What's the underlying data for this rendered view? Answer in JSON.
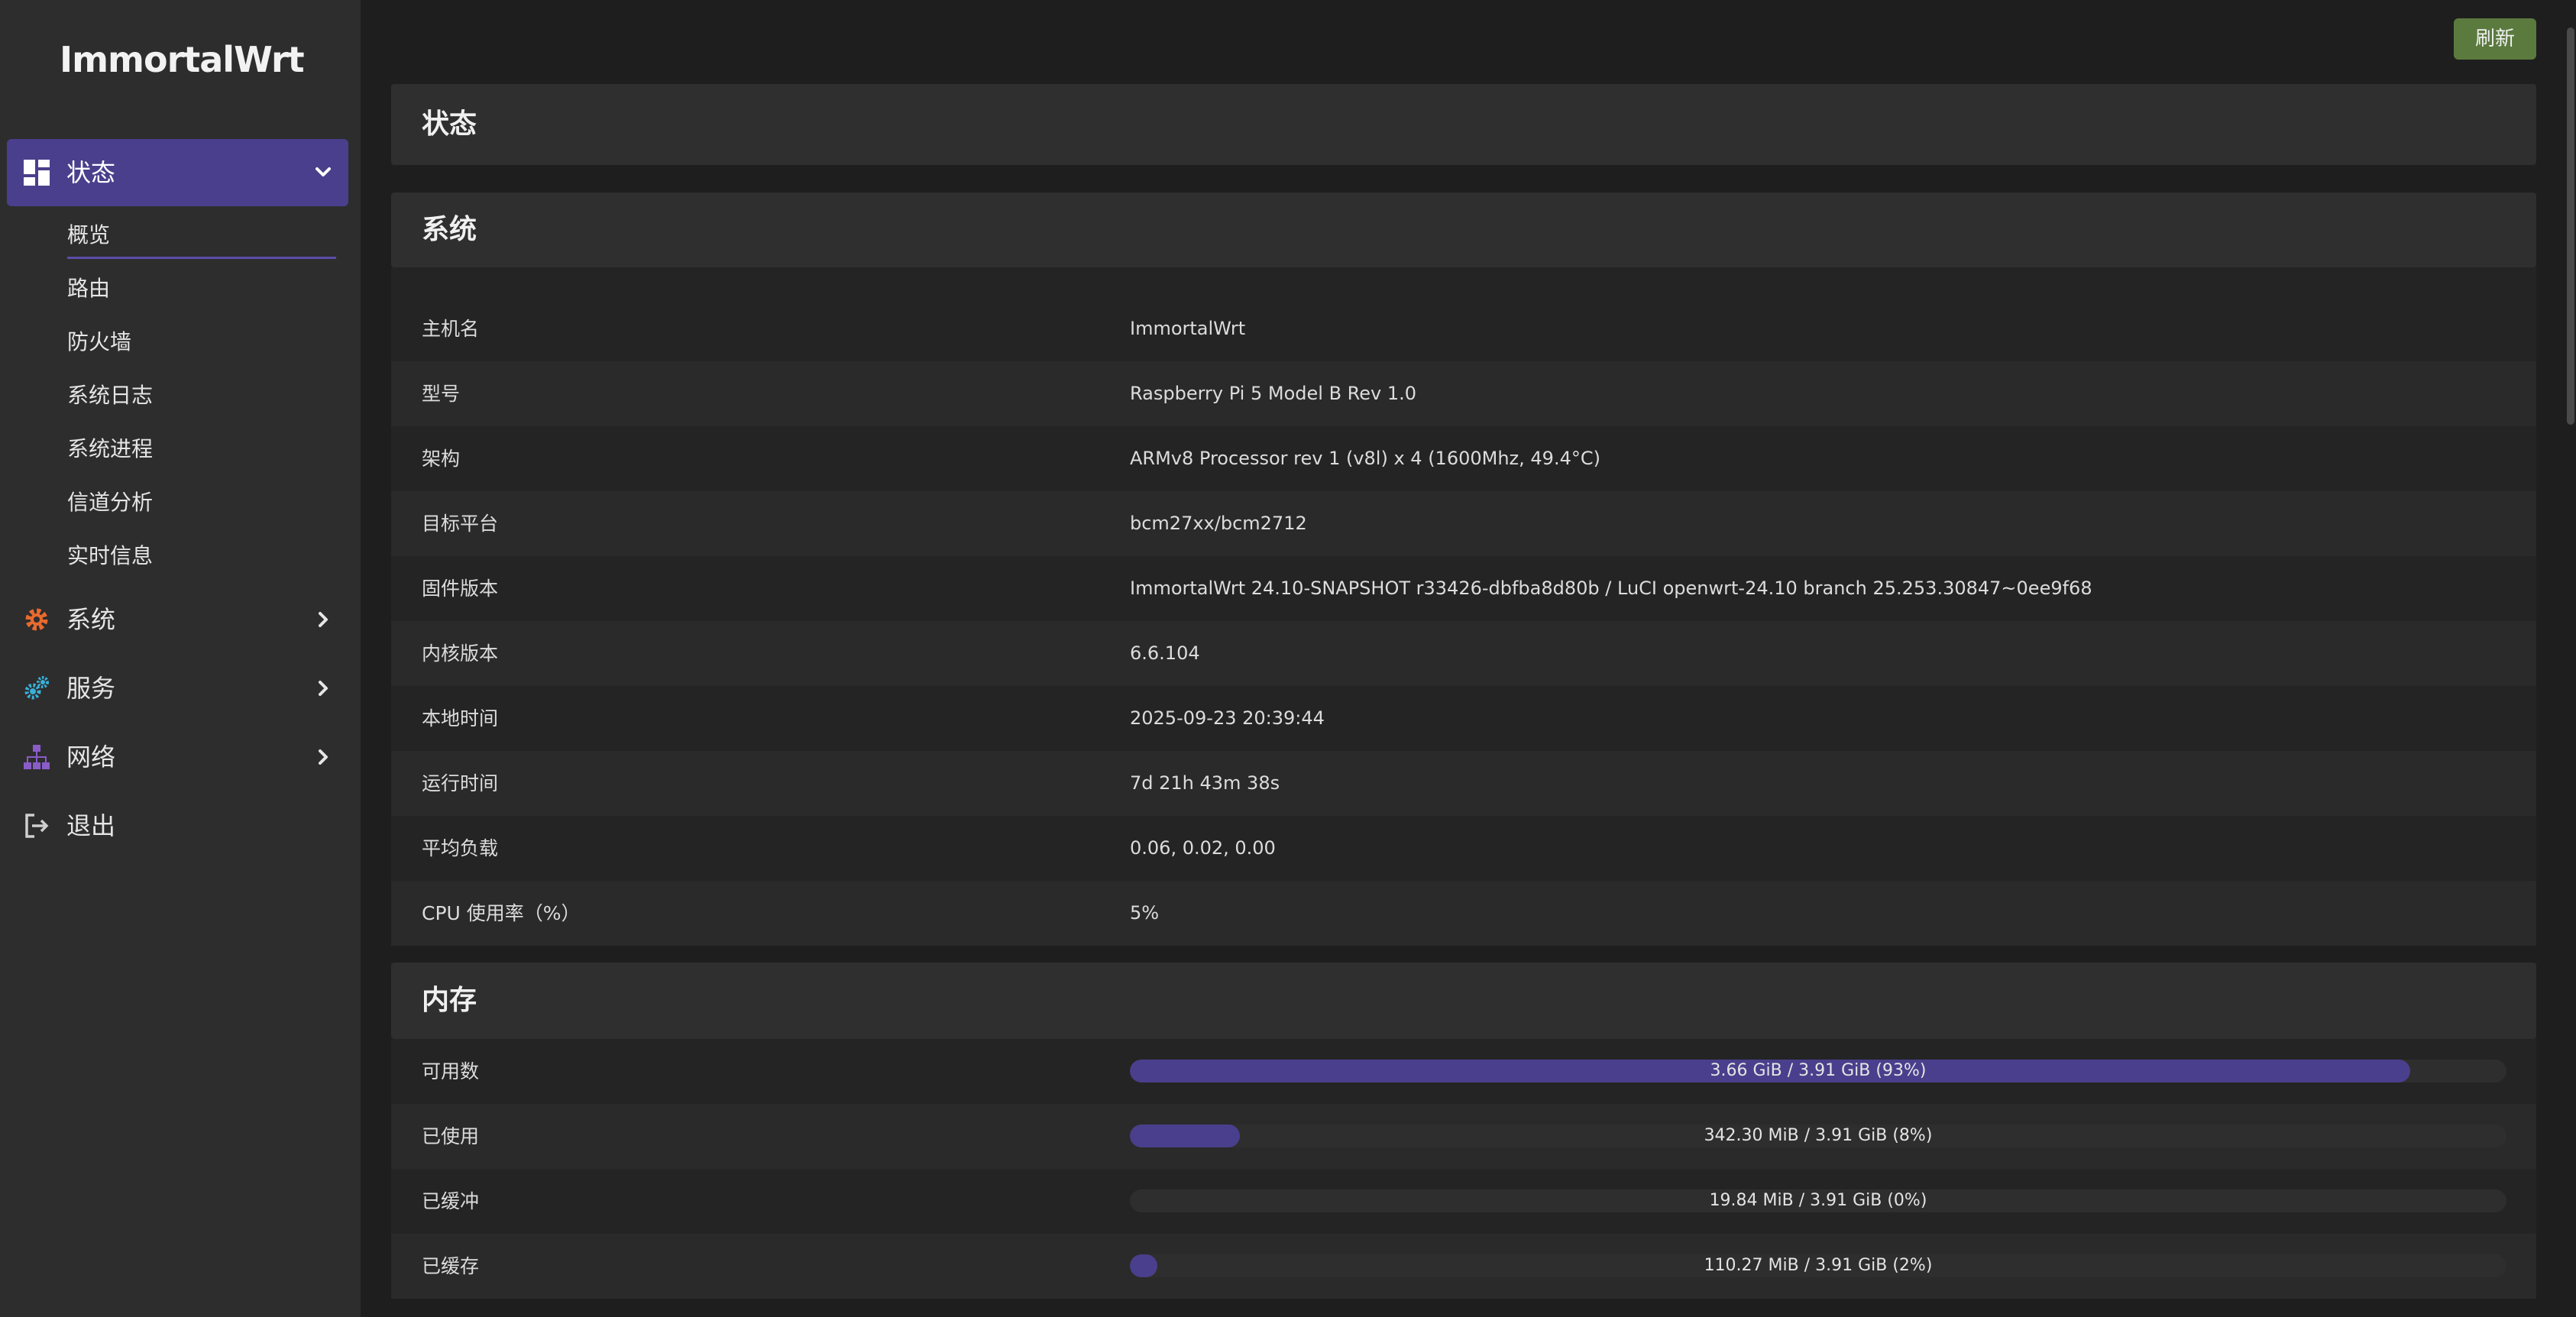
{
  "app": {
    "logo": "ImmortalWrt"
  },
  "sidebar": {
    "active": {
      "label": "状态"
    },
    "subitems": [
      "概览",
      "路由",
      "防火墙",
      "系统日志",
      "系统进程",
      "信道分析",
      "实时信息"
    ],
    "items": [
      {
        "label": "系统",
        "icon": "gear-icon"
      },
      {
        "label": "服务",
        "icon": "services-icon"
      },
      {
        "label": "网络",
        "icon": "network-icon"
      },
      {
        "label": "退出",
        "icon": "logout-icon"
      }
    ]
  },
  "header": {
    "refresh_label": "刷新"
  },
  "page": {
    "title": "状态"
  },
  "system": {
    "title": "系统",
    "rows": [
      {
        "key": "主机名",
        "value": "ImmortalWrt"
      },
      {
        "key": "型号",
        "value": "Raspberry Pi 5 Model B Rev 1.0"
      },
      {
        "key": "架构",
        "value": "ARMv8 Processor rev 1 (v8l) x 4 (1600Mhz, 49.4°C)"
      },
      {
        "key": "目标平台",
        "value": "bcm27xx/bcm2712"
      },
      {
        "key": "固件版本",
        "value": "ImmortalWrt 24.10-SNAPSHOT r33426-dbfba8d80b / LuCI openwrt-24.10 branch 25.253.30847~0ee9f68"
      },
      {
        "key": "内核版本",
        "value": "6.6.104"
      },
      {
        "key": "本地时间",
        "value": "2025-09-23 20:39:44"
      },
      {
        "key": "运行时间",
        "value": "7d 21h 43m 38s"
      },
      {
        "key": "平均负载",
        "value": "0.06, 0.02, 0.00"
      },
      {
        "key": "CPU 使用率（%）",
        "value": "5%"
      }
    ]
  },
  "memory": {
    "title": "内存",
    "rows": [
      {
        "key": "可用数",
        "text": "3.66 GiB / 3.91 GiB (93%)",
        "percent": 93
      },
      {
        "key": "已使用",
        "text": "342.30 MiB / 3.91 GiB (8%)",
        "percent": 8
      },
      {
        "key": "已缓冲",
        "text": "19.84 MiB / 3.91 GiB (0%)",
        "percent": 0
      },
      {
        "key": "已缓存",
        "text": "110.27 MiB / 3.91 GiB (2%)",
        "percent": 2
      }
    ]
  },
  "colors": {
    "accent": "#4a3f8c",
    "refresh": "#5b7a3e",
    "system_icon": "#e86a2e",
    "services_icon": "#3ab0d8",
    "network_icon": "#8a5cc8"
  }
}
